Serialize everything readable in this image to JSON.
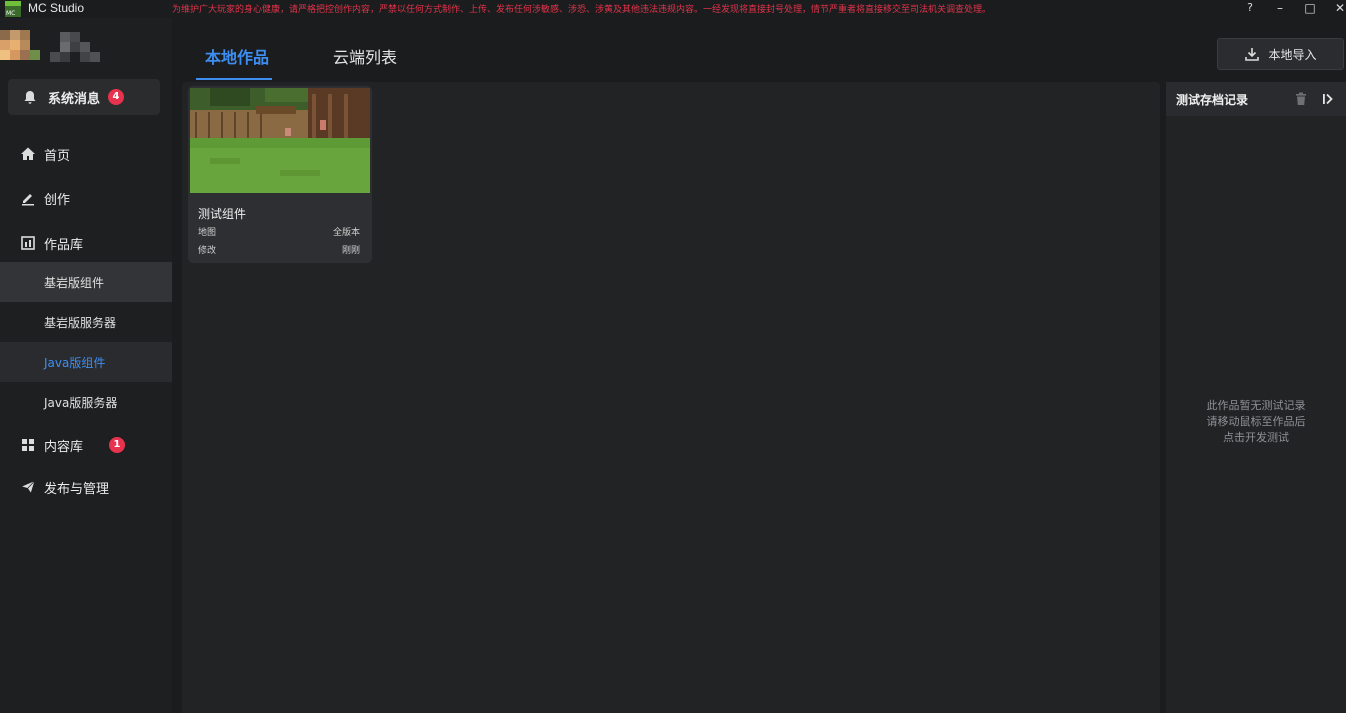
{
  "window": {
    "title": "MC Studio",
    "notice": "为维护广大玩家的身心健康，请严格把控创作内容，严禁以任何方式制作、上传、发布任何涉敏感、涉恐、涉黄及其他违法违规内容。一经发现将直接封号处理，情节严重者将直接移交至司法机关调查处理。",
    "logo_text": "MC",
    "buttons": {
      "help": "?",
      "minimize": "–",
      "maximize": "□",
      "close": "✕"
    }
  },
  "sidebar": {
    "system_messages": {
      "label": "系统消息",
      "count": "4"
    },
    "nav": {
      "home": "首页",
      "create": "创作",
      "library": "作品库",
      "content_library": {
        "label": "内容库",
        "count": "1"
      },
      "publish": "发布与管理"
    },
    "library_items": [
      "基岩版组件",
      "基岩版服务器",
      "Java版组件",
      "Java版服务器"
    ],
    "active_library_item": "Java版组件"
  },
  "main": {
    "tabs": [
      "本地作品",
      "云端列表"
    ],
    "active_tab": "本地作品",
    "import_button": "本地导入"
  },
  "works": [
    {
      "title": "测试组件",
      "type": "地图",
      "version": "全版本",
      "modified_label": "修改",
      "modified_time": "刚刚"
    }
  ],
  "test_panel": {
    "title": "测试存档记录",
    "empty_lines": [
      "此作品暂无测试记录",
      "请移动鼠标至作品后",
      "点击开发测试"
    ]
  },
  "colors": {
    "accent": "#3d8ef0",
    "badge": "#e8334f",
    "notice": "#e0344a",
    "background": "#1b1c1e"
  },
  "icons": [
    "bell-icon",
    "home-icon",
    "pen-icon",
    "library-icon",
    "grid-icon",
    "paper-plane-icon",
    "download-icon",
    "trash-icon",
    "collapse-panel-icon"
  ]
}
